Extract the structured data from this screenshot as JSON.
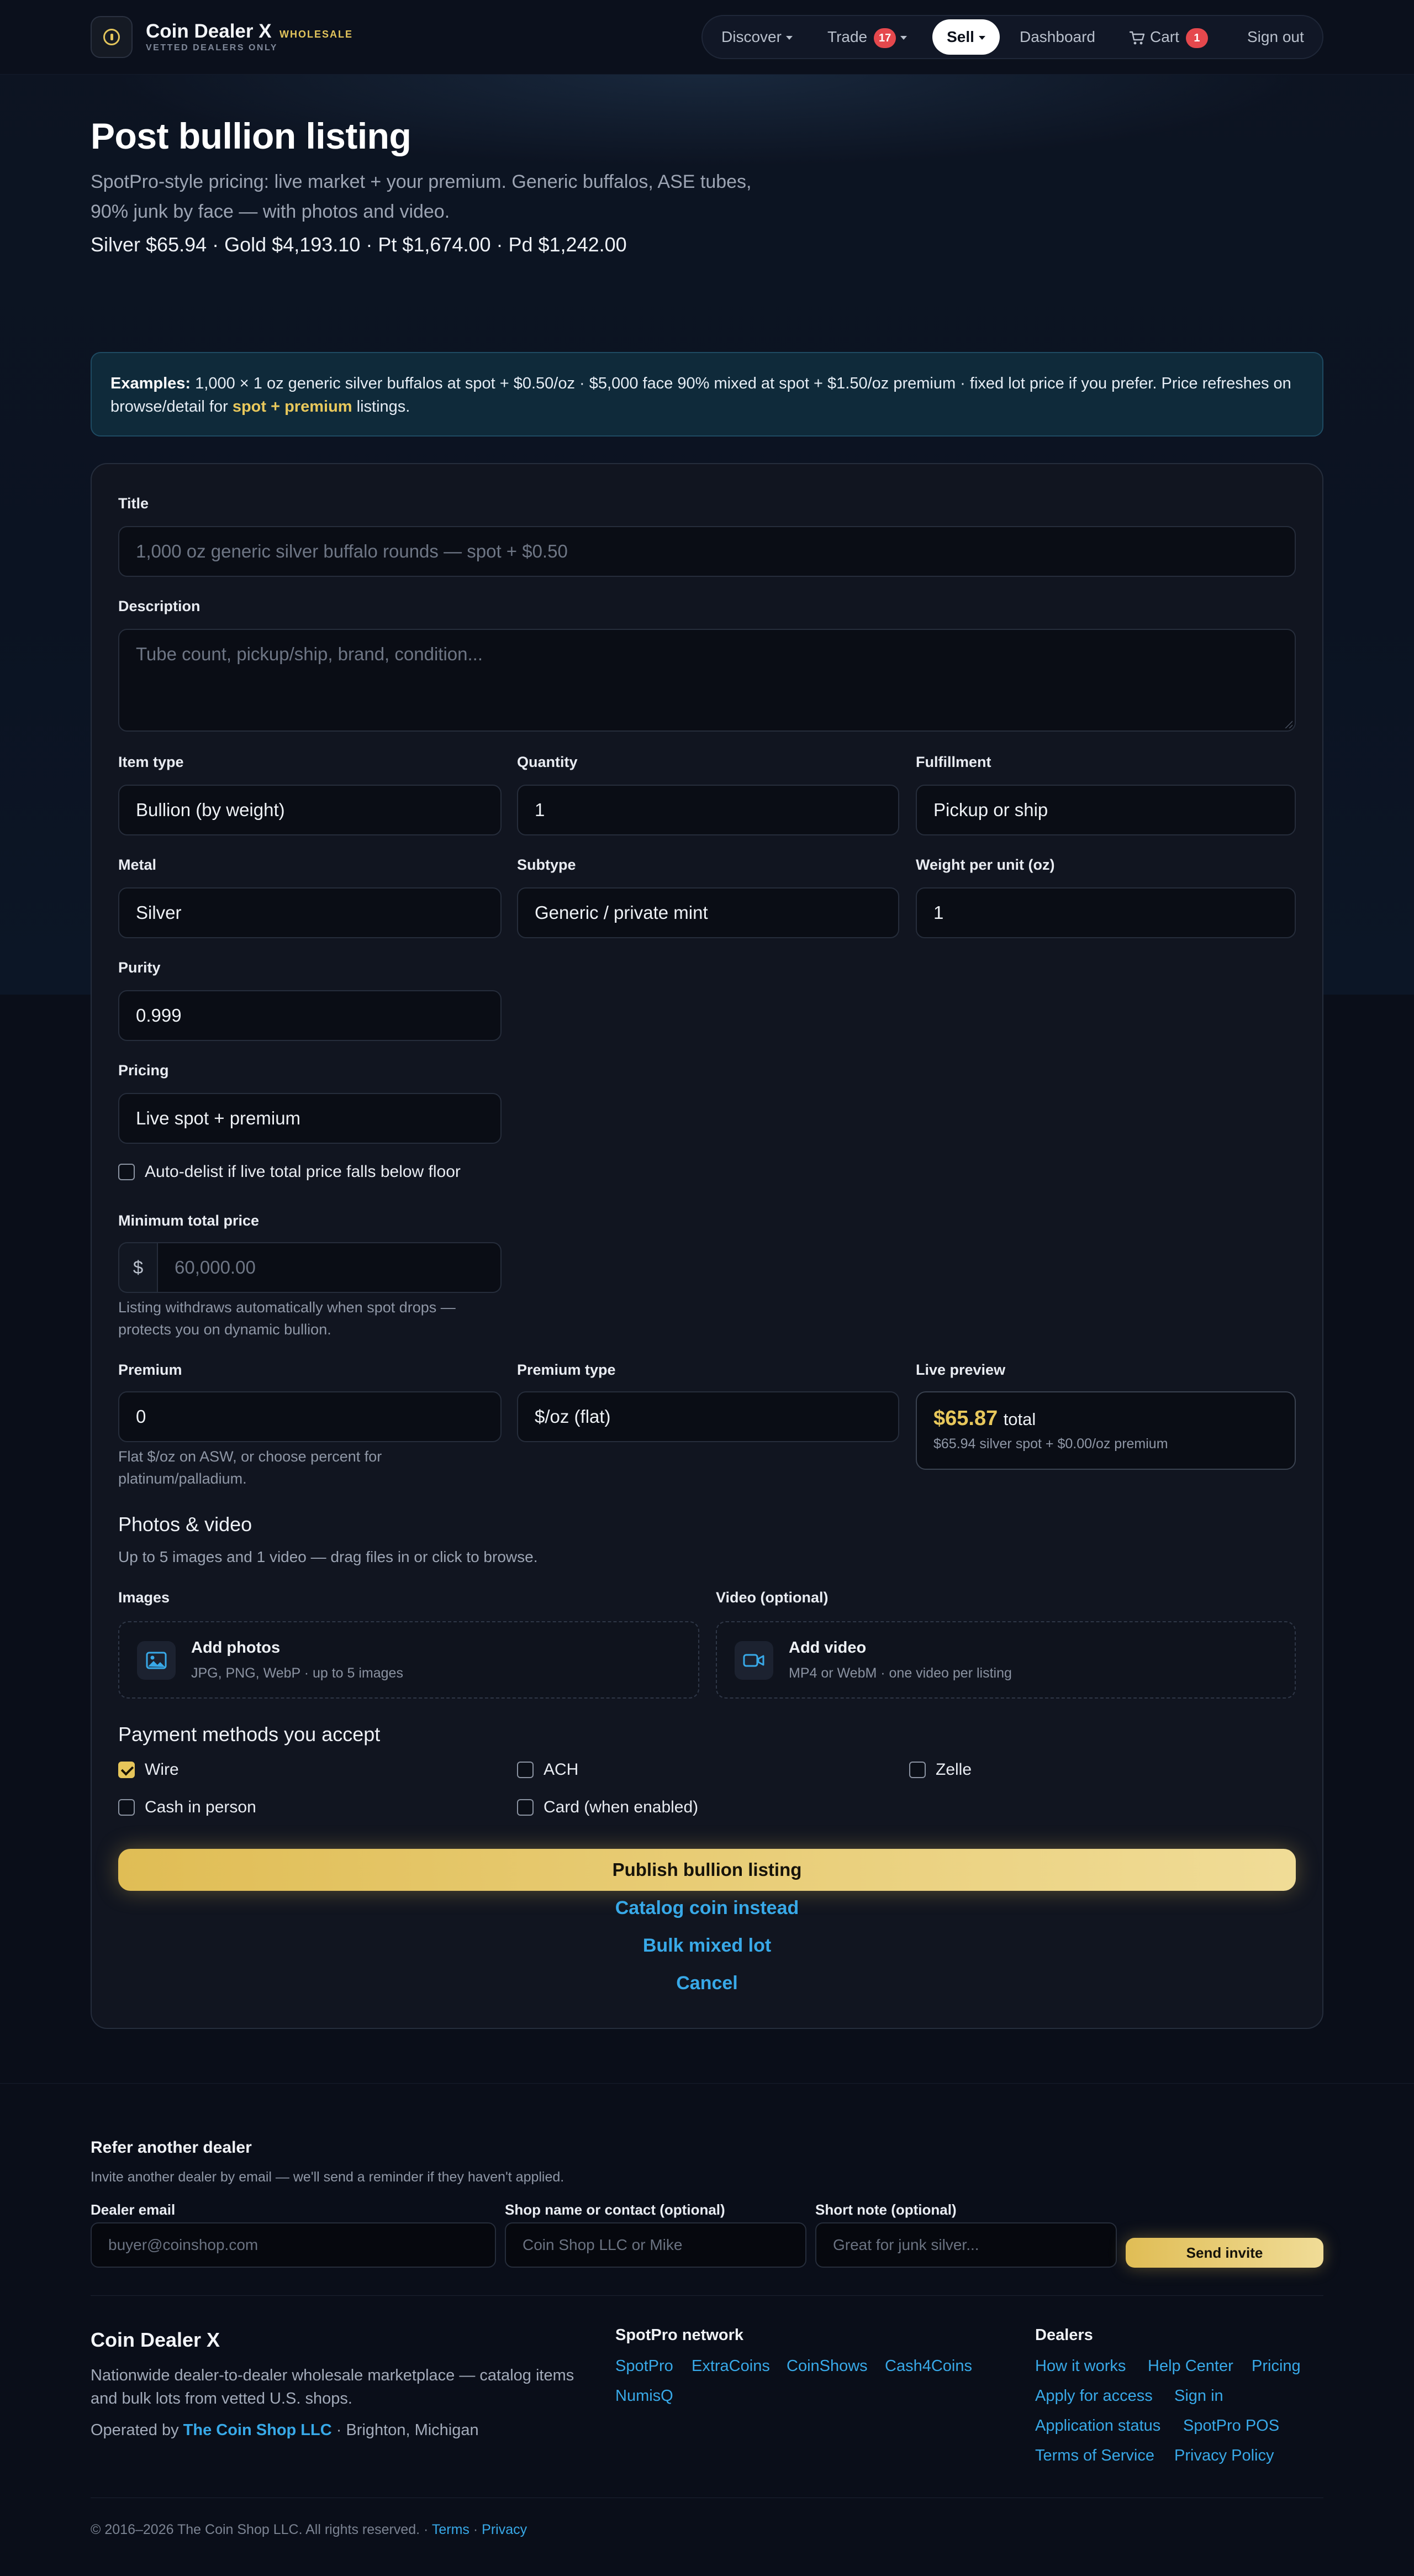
{
  "brand": {
    "name": "Coin Dealer X",
    "tag": "WHOLESALE",
    "sub": "VETTED DEALERS ONLY"
  },
  "nav": {
    "discover": "Discover",
    "trade": "Trade",
    "trade_badge": "17",
    "sell": "Sell",
    "dashboard": "Dashboard",
    "cart": "Cart",
    "cart_badge": "1",
    "signout": "Sign out"
  },
  "page": {
    "title": "Post bullion listing",
    "subtitle": "SpotPro-style pricing: live market + your premium. Generic buffalos, ASE tubes, 90% junk by face — with photos and video.",
    "spot": "Silver $65.94 · Gold $4,193.10 · Pt $1,674.00 · Pd $1,242.00"
  },
  "examples": {
    "lead": "Examples:",
    "text": " 1,000 × 1 oz generic silver buffalos at spot + $0.50/oz · $5,000 face 90% mixed at spot + $1.50/oz premium · fixed lot price if you prefer. Price refreshes on browse/detail for ",
    "highlight": "spot + premium",
    "tail": " listings."
  },
  "form": {
    "title_label": "Title",
    "title_placeholder": "1,000 oz generic silver buffalo rounds — spot + $0.50",
    "desc_label": "Description",
    "desc_placeholder": "Tube count, pickup/ship, brand, condition...",
    "item_type_label": "Item type",
    "item_type_value": "Bullion (by weight)",
    "quantity_label": "Quantity",
    "quantity_value": "1",
    "fulfillment_label": "Fulfillment",
    "fulfillment_value": "Pickup or ship",
    "metal_label": "Metal",
    "metal_value": "Silver",
    "subtype_label": "Subtype",
    "subtype_value": "Generic / private mint",
    "weight_label": "Weight per unit (oz)",
    "weight_value": "1",
    "purity_label": "Purity",
    "purity_value": "0.999",
    "pricing_label": "Pricing",
    "pricing_value": "Live spot + premium",
    "autodelist_label": "Auto-delist if live total price falls below floor",
    "min_label": "Minimum total price",
    "min_prefix": "$",
    "min_placeholder": "60,000.00",
    "min_hint": "Listing withdraws automatically when spot drops — protects you on dynamic bullion.",
    "premium_label": "Premium",
    "premium_value": "0",
    "premium_hint": "Flat $/oz on ASW, or choose percent for platinum/palladium.",
    "premium_type_label": "Premium type",
    "premium_type_value": "$/oz (flat)",
    "preview_label": "Live preview",
    "preview_amount": "$65.87",
    "preview_total": "total",
    "preview_sub": "$65.94 silver spot + $0.00/oz premium"
  },
  "media": {
    "heading": "Photos & video",
    "sub": "Up to 5 images and 1 video — drag files in or click to browse.",
    "images_label": "Images",
    "images_title": "Add photos",
    "images_sub": "JPG, PNG, WebP · up to 5 images",
    "video_label": "Video (optional)",
    "video_title": "Add video",
    "video_sub": "MP4 or WebM · one video per listing"
  },
  "payment": {
    "heading": "Payment methods you accept",
    "wire": "Wire",
    "ach": "ACH",
    "zelle": "Zelle",
    "cash": "Cash in person",
    "card": "Card (when enabled)"
  },
  "actions": {
    "publish": "Publish bullion listing",
    "catalog": "Catalog coin instead",
    "bulk": "Bulk mixed lot",
    "cancel": "Cancel"
  },
  "refer": {
    "heading": "Refer another dealer",
    "sub": "Invite another dealer by email — we'll send a reminder if they haven't applied.",
    "email_label": "Dealer email",
    "email_placeholder": "buyer@coinshop.com",
    "shop_label": "Shop name or contact (optional)",
    "shop_placeholder": "Coin Shop LLC or Mike",
    "note_label": "Short note (optional)",
    "note_placeholder": "Great for junk silver...",
    "send": "Send invite"
  },
  "footer": {
    "brand": "Coin Dealer X",
    "desc": "Nationwide dealer-to-dealer wholesale marketplace — catalog items and bulk lots from vetted U.S. shops.",
    "op_prefix": "Operated by ",
    "op_link": "The Coin Shop LLC",
    "op_suffix": " · Brighton, Michigan",
    "network_heading": "SpotPro network",
    "network": [
      "SpotPro",
      "ExtraCoins",
      "CoinShows",
      "Cash4Coins",
      "NumisQ"
    ],
    "dealers_heading": "Dealers",
    "dealers": [
      "How it works",
      "Help Center",
      "Pricing",
      "Apply for access",
      "Sign in",
      "Application status",
      "SpotPro POS",
      "Terms of Service",
      "Privacy Policy"
    ],
    "copyright": "© 2016–2026 The Coin Shop LLC. All rights reserved. · ",
    "terms": "Terms",
    "dot": " · ",
    "privacy": "Privacy"
  },
  "colors": {
    "accent_gold": "#e3c55c",
    "link_blue": "#38a9e8",
    "badge_red": "#e5484d"
  }
}
